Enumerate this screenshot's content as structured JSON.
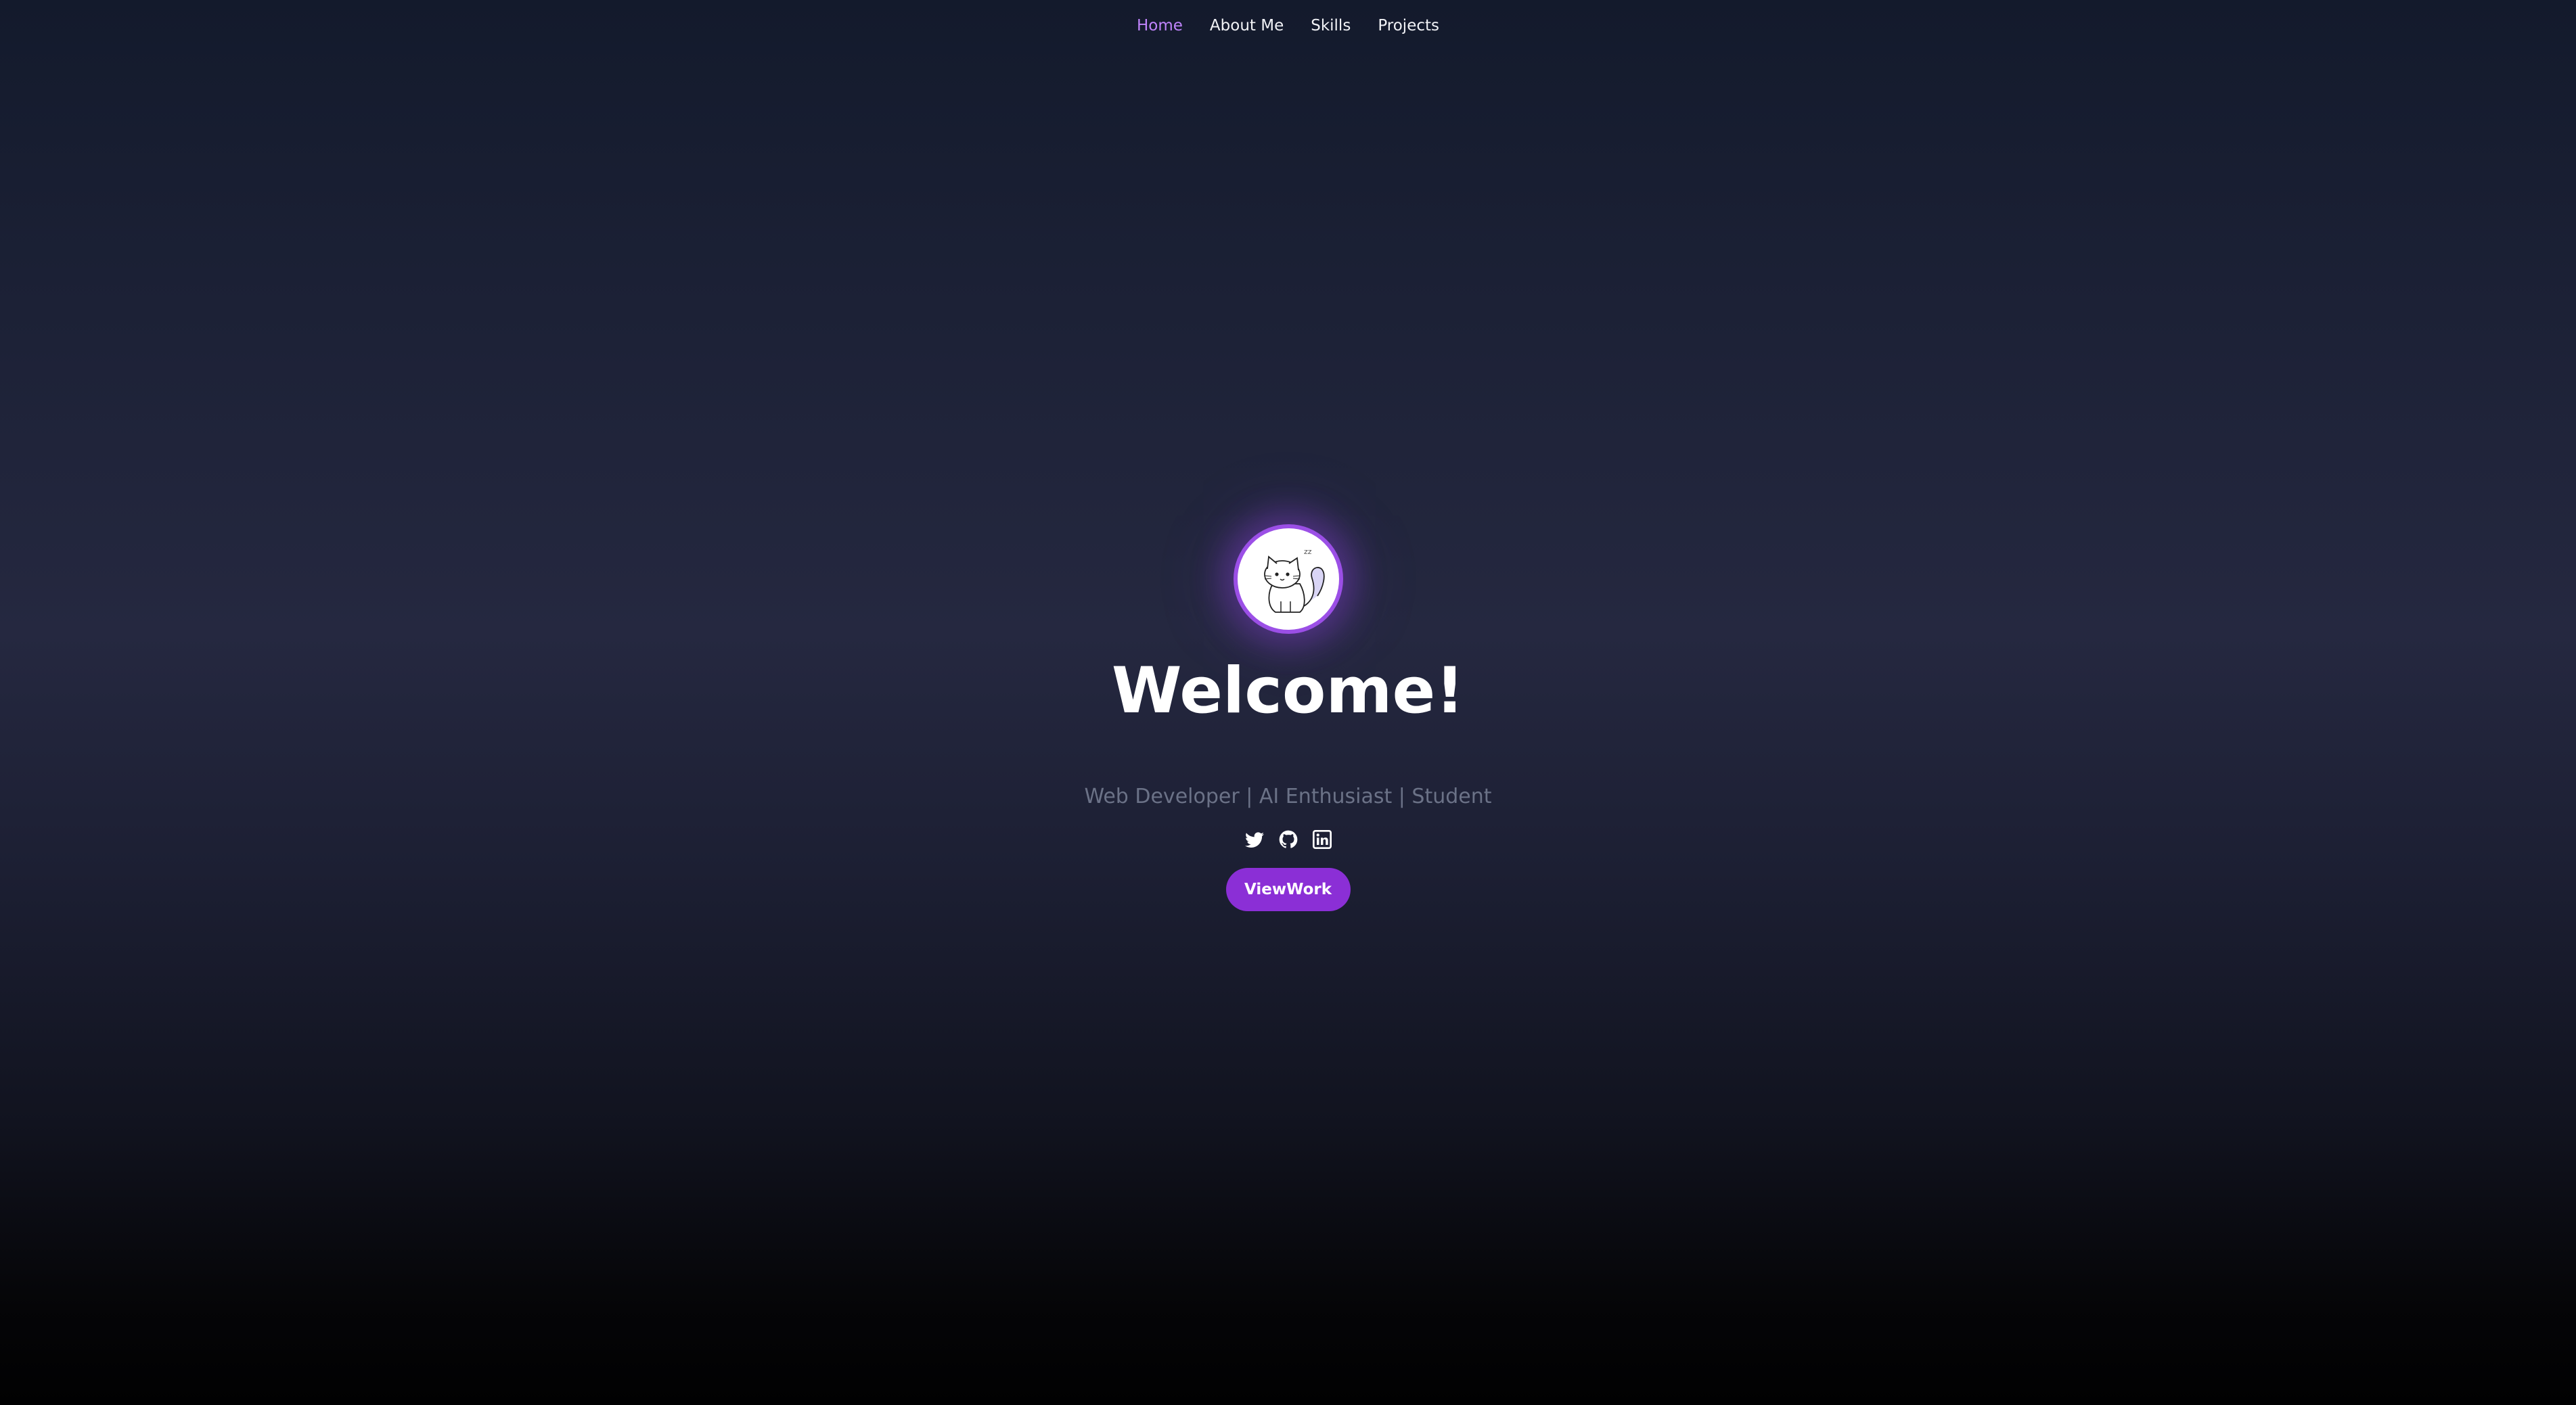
{
  "nav": {
    "items": [
      {
        "label": "Home",
        "active": true
      },
      {
        "label": "About Me",
        "active": false
      },
      {
        "label": "Skills",
        "active": false
      },
      {
        "label": "Projects",
        "active": false
      }
    ]
  },
  "hero": {
    "title": "Welcome!",
    "subtitle": "Web Developer | AI Enthusiast | Student",
    "socials": [
      {
        "icon": "twitter-icon"
      },
      {
        "icon": "github-icon"
      },
      {
        "icon": "linkedin-icon"
      }
    ],
    "cta_label": "ViewWork"
  },
  "colors": {
    "accent": "#8b2fd6",
    "active_nav": "#c084fc",
    "avatar_ring": "#9b4fe6",
    "subtitle": "#6b7287"
  }
}
